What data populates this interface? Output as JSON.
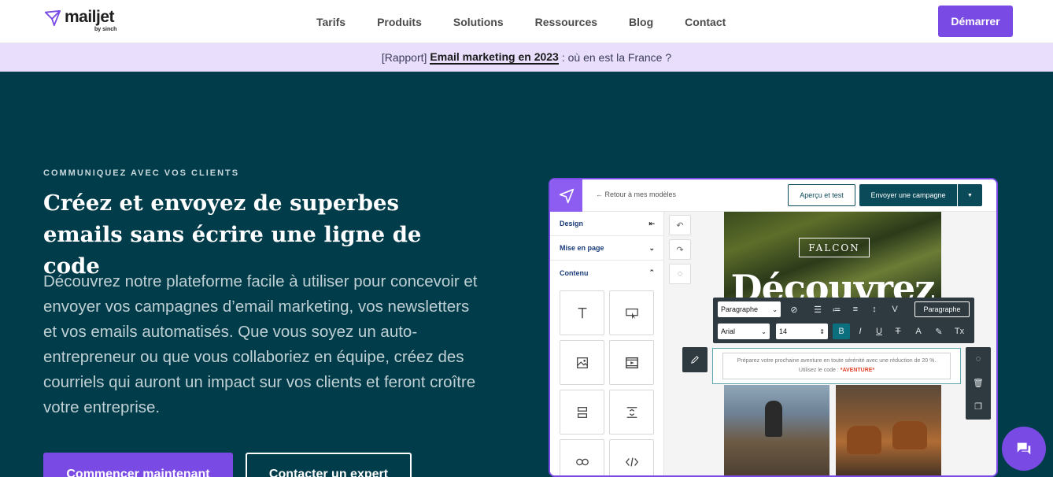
{
  "nav": {
    "logo_text": "mailjet",
    "logo_sub": "by sinch",
    "links": [
      "Tarifs",
      "Produits",
      "Solutions",
      "Ressources",
      "Blog",
      "Contact"
    ],
    "start_label": "Démarrer"
  },
  "banner": {
    "prefix": "[Rapport]",
    "link": "Email marketing en 2023",
    "suffix": ": où en est la France ?"
  },
  "hero": {
    "eyebrow": "COMMUNIQUEZ AVEC VOS CLIENTS",
    "headline": "Créez et envoyez de superbes emails sans écrire une ligne de code",
    "description": "Découvrez notre plateforme facile à utiliser pour concevoir et envoyer vos campagnes d’email marketing, vos newsletters et vos emails automatisés. Que vous soyez un auto-entrepreneur ou que vous collaboriez en équipe, créez des courriels qui auront un impact sur vos clients et feront croître votre entreprise.",
    "primary_cta": "Commencer maintenant",
    "secondary_cta": "Contacter un expert"
  },
  "editor": {
    "back_link": "← Retour à mes modèles",
    "preview_btn": "Aperçu et test",
    "send_btn": "Envoyer une campagne",
    "panel": {
      "design": "Design",
      "layout": "Mise en page",
      "content": "Contenu"
    },
    "tiles": [
      "text-tile-icon",
      "button-tile-icon",
      "image-tile-icon",
      "video-tile-icon",
      "section-tile-icon",
      "spacer-tile-icon",
      "social-tile-icon",
      "html-tile-icon"
    ],
    "canvas": {
      "brand": "FALCON",
      "big_word": "Découvrez",
      "paragraph_select": "Paragraphe",
      "font_select": "Arial",
      "size_value": "14",
      "para_btn": "Paragraphe",
      "body_text": "Préparez votre prochaine aventure en toute sérénité avec une réduction de 20 %.",
      "code_prefix": "Utilisez le code :",
      "code_value": "*AVENTURE*"
    }
  },
  "colors": {
    "brand_purple": "#7a4be4",
    "hero_bg": "#013c4a",
    "banner_bg": "#e9dffc",
    "editor_teal": "#0b4b59"
  }
}
